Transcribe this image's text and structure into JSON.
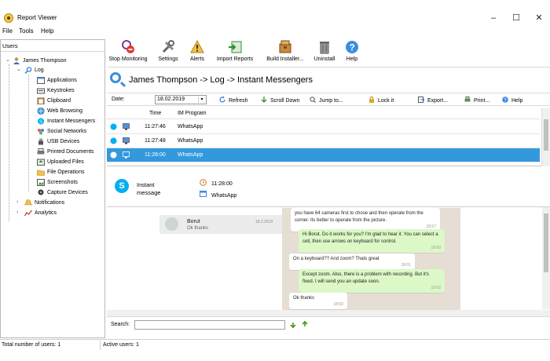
{
  "window": {
    "title": "Report Viewer",
    "minimize_glyph": "–",
    "maximize_glyph": "☐",
    "close_glyph": "✕"
  },
  "menu": [
    "File",
    "Tools",
    "Help"
  ],
  "sidebar": {
    "header": "Users",
    "user": "James Thompson",
    "log": "Log",
    "log_items": [
      "Applications",
      "Keystrokes",
      "Clipboard",
      "Web Browsing",
      "Instant Messengers",
      "Social Networks",
      "USB Devices",
      "Printed Documents",
      "Uploaded Files",
      "File Operations",
      "Screenshots",
      "Capture Devices"
    ],
    "notifications": "Notifications",
    "analytics": "Analytics"
  },
  "toolbar": {
    "items": [
      {
        "label": "Stop Monitoring",
        "icon": "stop-monitoring-icon"
      },
      {
        "label": "Settings",
        "icon": "settings-tools-icon"
      },
      {
        "label": "Alerts",
        "icon": "warning-icon"
      },
      {
        "label": "Import Reports",
        "icon": "import-icon"
      },
      {
        "label": "Build Installer...",
        "icon": "installer-icon"
      },
      {
        "label": "Uninstall",
        "icon": "trash-icon"
      },
      {
        "label": "Help",
        "icon": "help-icon"
      }
    ]
  },
  "breadcrumb": "James Thompson -> Log -> Instant Messengers",
  "datebar": {
    "date_label": "Date:",
    "date_value": "18.02.2019",
    "refresh": "Refresh",
    "scroll_down": "Scroll Down",
    "jump_to": "Jump to...",
    "lock_it": "Lock it",
    "export": "Export...",
    "print": "Print...",
    "help": "Help"
  },
  "grid": {
    "columns": [
      "Time",
      "IM Program"
    ],
    "rows": [
      {
        "time": "11:27:46",
        "program": "WhatsApp",
        "selected": false
      },
      {
        "time": "11:27:48",
        "program": "WhatsApp",
        "selected": false
      },
      {
        "time": "11:28:00",
        "program": "WhatsApp",
        "selected": true
      }
    ]
  },
  "detail": {
    "label": "Instant message",
    "time": "11:28:00",
    "program": "WhatsApp"
  },
  "chat": {
    "contact_name": "Borut",
    "contact_date": "18.2.2019",
    "contact_preview": "Ok thanks",
    "messages": [
      {
        "dir": "in",
        "text": "you have 64 cameras first to chose and then operate from the corner. Its better to operate from the picture.",
        "time": "18:57"
      },
      {
        "dir": "out",
        "text": "Hi Borut. Do it works for you? I'm glad to hear it. You can select a cell, then use arrows on keyboard for control.",
        "time": "19:00"
      },
      {
        "dir": "in",
        "text": "On a keyboard?? And zoom? Thats great",
        "time": "18:01"
      },
      {
        "dir": "out",
        "text": "Except zoom. Also, there is a problem with recording. But it's fixed. I will send you an update soon.",
        "time": "19:02"
      },
      {
        "dir": "in",
        "text": "Ok thanks",
        "time": "18:02"
      }
    ]
  },
  "search": {
    "label": "Search:",
    "value": ""
  },
  "status": {
    "total_users": "Total number of users: 1",
    "active_users": "Active users: 1"
  },
  "colors": {
    "selection": "#3399dd",
    "accent_blue": "#3a8ddc",
    "chat_background": "#e6ddd4",
    "outgoing_bubble": "#dcf8c6"
  }
}
